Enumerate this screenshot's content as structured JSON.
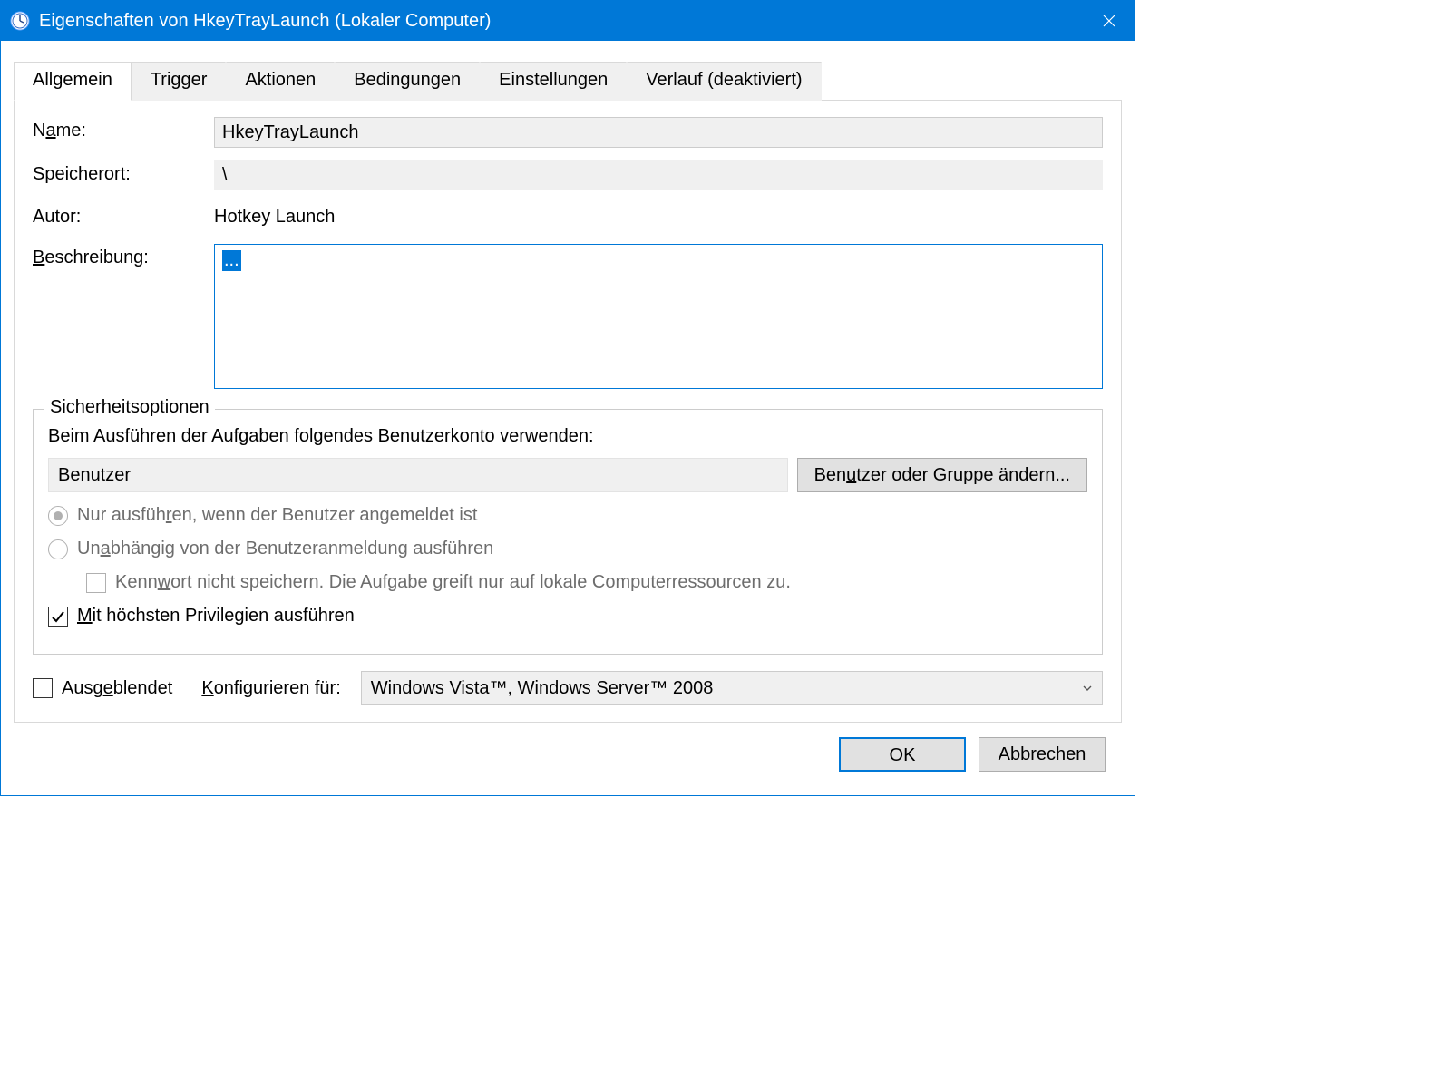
{
  "window": {
    "title": "Eigenschaften von HkeyTrayLaunch (Lokaler Computer)"
  },
  "tabs": [
    {
      "id": "allgemein",
      "label": "Allgemein",
      "active": true
    },
    {
      "id": "trigger",
      "label": "Trigger",
      "active": false
    },
    {
      "id": "aktionen",
      "label": "Aktionen",
      "active": false
    },
    {
      "id": "bedingungen",
      "label": "Bedingungen",
      "active": false
    },
    {
      "id": "einstellungen",
      "label": "Einstellungen",
      "active": false
    },
    {
      "id": "verlauf",
      "label": "Verlauf (deaktiviert)",
      "active": false
    }
  ],
  "general": {
    "name_label_pre": "N",
    "name_label_u": "a",
    "name_label_post": "me:",
    "name_value": "HkeyTrayLaunch",
    "location_label": "Speicherort:",
    "location_value": "\\",
    "author_label": "Autor:",
    "author_value": "Hotkey Launch",
    "description_label_pre": "",
    "description_label_u": "B",
    "description_label_post": "eschreibung:",
    "description_value": "..."
  },
  "security": {
    "group_title": "Sicherheitsoptionen",
    "account_label": "Beim Ausführen der Aufgaben folgendes Benutzerkonto verwenden:",
    "account_value": "Benutzer",
    "change_user_btn_pre": "Ben",
    "change_user_btn_u": "u",
    "change_user_btn_post": "tzer oder Gruppe ändern...",
    "radio_logged_on_pre": "Nur ausfüh",
    "radio_logged_on_u": "r",
    "radio_logged_on_post": "en, wenn der Benutzer angemeldet ist",
    "radio_any_pre": "Un",
    "radio_any_u": "a",
    "radio_any_post": "bhängig von der Benutzeranmeldung ausführen",
    "chk_nopwd_pre": "Kenn",
    "chk_nopwd_u": "w",
    "chk_nopwd_post": "ort nicht speichern. Die Aufgabe greift nur auf lokale Computerressourcen zu.",
    "chk_highest_pre": "",
    "chk_highest_u": "M",
    "chk_highest_post": "it höchsten Privilegien ausführen"
  },
  "bottom": {
    "hidden_pre": "Ausg",
    "hidden_u": "e",
    "hidden_post": "blendet",
    "configure_pre": "",
    "configure_u": "K",
    "configure_post": "onfigurieren für:",
    "configure_value": "Windows Vista™, Windows Server™ 2008"
  },
  "footer": {
    "ok": "OK",
    "cancel": "Abbrechen"
  }
}
